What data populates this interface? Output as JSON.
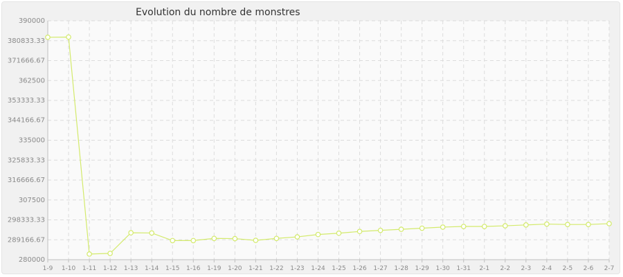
{
  "chart_data": {
    "type": "line",
    "title": "Evolution du nombre de monstres",
    "xlabel": "",
    "ylabel": "",
    "ylim": [
      280000,
      390000
    ],
    "yticks": [
      "280000",
      "289166.67",
      "298333.33",
      "307500",
      "316666.67",
      "325833.33",
      "335000",
      "344166.67",
      "353333.33",
      "362500",
      "371666.67",
      "380833.33",
      "390000"
    ],
    "categories": [
      "1-9",
      "1-10",
      "1-11",
      "1-12",
      "1-13",
      "1-14",
      "1-15",
      "1-16",
      "1-19",
      "1-20",
      "1-21",
      "1-22",
      "1-23",
      "1-24",
      "1-25",
      "1-26",
      "1-27",
      "1-28",
      "1-29",
      "1-30",
      "1-31",
      "2-1",
      "2-2",
      "2-3",
      "2-4",
      "2-5",
      "2-6",
      "2-7"
    ],
    "series": [
      {
        "values": [
          382400,
          382500,
          282600,
          282900,
          292400,
          292300,
          288800,
          288800,
          289800,
          289700,
          288900,
          289800,
          290500,
          291600,
          292200,
          293000,
          293500,
          294000,
          294500,
          295000,
          295300,
          295300,
          295600,
          296000,
          296400,
          296200,
          296200,
          296600
        ]
      }
    ],
    "grid": true,
    "legend": "none",
    "colors": {
      "line": "#d3ea6b",
      "marker_fill": "#ffffff",
      "background": "#f1f1f1",
      "plot_background": "#fafafa",
      "grid": "#dcdcdc",
      "text": "#8a8a8a"
    }
  }
}
